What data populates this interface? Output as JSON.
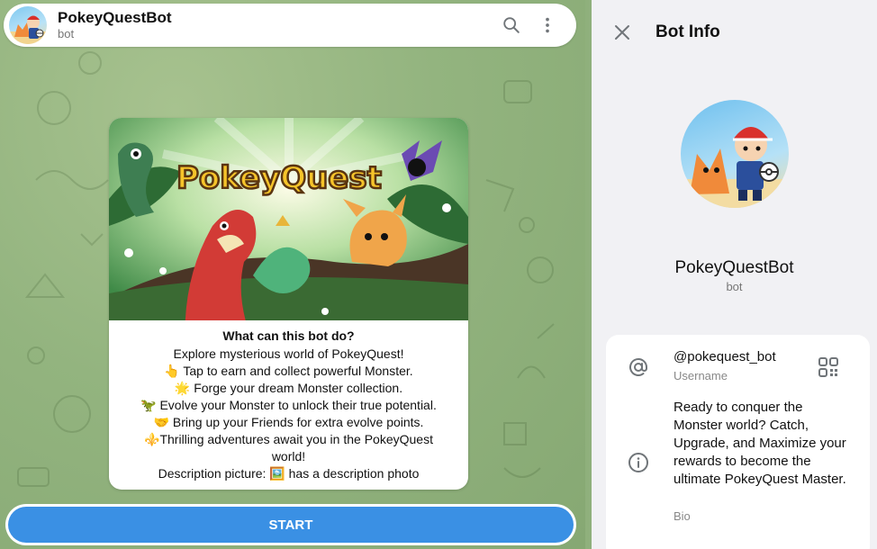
{
  "chat": {
    "title": "PokeyQuestBot",
    "subtitle": "bot",
    "icons": {
      "search": "search-icon",
      "more": "more-vertical-icon"
    }
  },
  "card": {
    "banner_logo": "PokeyQuest",
    "heading": "What can this bot do?",
    "lines": [
      "Explore mysterious world of PokeyQuest!",
      "👆 Tap to earn and collect powerful Monster.",
      "🌟 Forge your dream Monster collection.",
      "🦖 Evolve your Monster to unlock their true potential.",
      "🤝 Bring up your Friends for extra evolve points.",
      "⚜️Thrilling adventures await you in the PokeyQuest",
      "world!",
      "Description picture: 🖼️ has a description photo"
    ]
  },
  "start_button": {
    "label": "START"
  },
  "panel": {
    "title": "Bot Info",
    "name": "PokeyQuestBot",
    "sub": "bot",
    "username": "@pokequest_bot",
    "username_label": "Username",
    "bio": "Ready to conquer the Monster world? Catch, Upgrade, and Maximize your rewards to become the ultimate PokeyQuest Master.",
    "bio_label": "Bio",
    "icons": {
      "close": "close-icon",
      "at": "at-sign-icon",
      "qr": "qr-code-icon",
      "info": "info-icon"
    }
  },
  "colors": {
    "accent": "#3a90e4",
    "chat_bg": "#93b47f",
    "panel_bg": "#f1f1f4"
  }
}
